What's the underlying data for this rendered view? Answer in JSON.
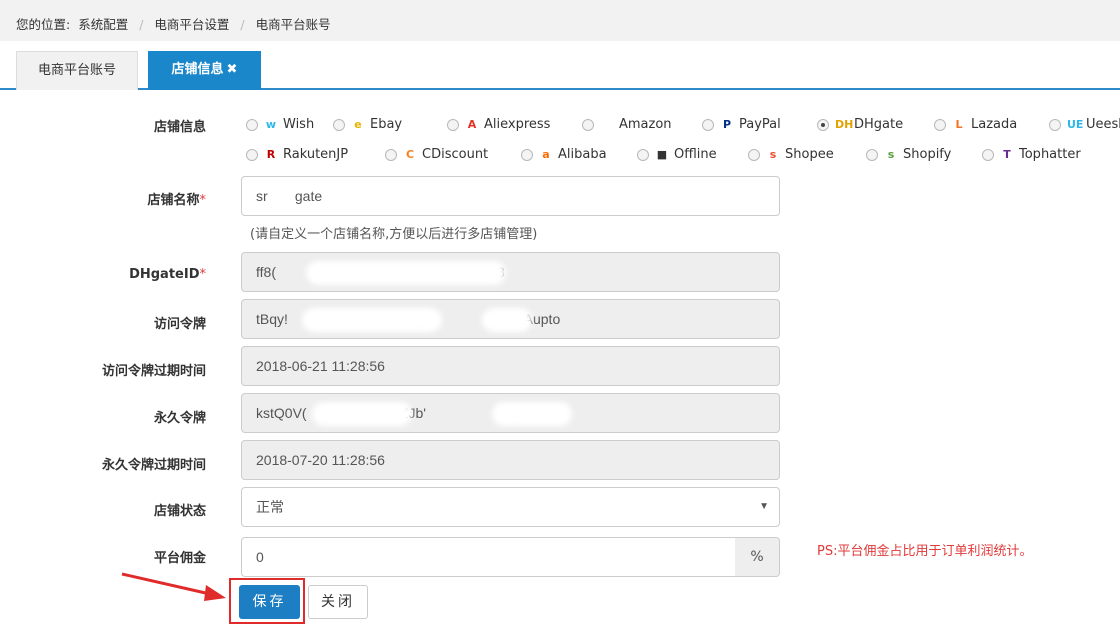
{
  "breadcrumb": {
    "prefix": "您的位置:",
    "items": [
      "系统配置",
      "电商平台设置",
      "电商平台账号"
    ]
  },
  "tabs": [
    {
      "label": "电商平台账号"
    },
    {
      "label": "店铺信息",
      "close": "✖"
    }
  ],
  "form": {
    "platform_label": "店铺信息",
    "platforms": [
      {
        "name": "Wish",
        "icon": "wish-icon",
        "color": "#2fb7ec",
        "glyph": "w",
        "selected": false
      },
      {
        "name": "Ebay",
        "icon": "ebay-icon",
        "color": "#e5b400",
        "glyph": "e",
        "selected": false
      },
      {
        "name": "Aliexpress",
        "icon": "aliexpress-icon",
        "color": "#e43225",
        "glyph": "A",
        "selected": false
      },
      {
        "name": "Amazon",
        "icon": "",
        "color": "",
        "glyph": "",
        "selected": false
      },
      {
        "name": "PayPal",
        "icon": "paypal-icon",
        "color": "#003087",
        "glyph": "P",
        "selected": false
      },
      {
        "name": "DHgate",
        "icon": "dhgate-icon",
        "color": "#e5a100",
        "glyph": "DH",
        "selected": true
      },
      {
        "name": "Lazada",
        "icon": "lazada-icon",
        "color": "#f57224",
        "glyph": "L",
        "selected": false
      },
      {
        "name": "Ueeshop",
        "icon": "ueeshop-icon",
        "color": "#2fb7ec",
        "glyph": "UE",
        "selected": false
      },
      {
        "name": "RakutenJP",
        "icon": "rakuten-icon",
        "color": "#bf0000",
        "glyph": "R",
        "selected": false
      },
      {
        "name": "CDiscount",
        "icon": "cdiscount-icon",
        "color": "#f58220",
        "glyph": "C",
        "selected": false
      },
      {
        "name": "Alibaba",
        "icon": "alibaba-icon",
        "color": "#ff6a00",
        "glyph": "a",
        "selected": false
      },
      {
        "name": "Offline",
        "icon": "offline-icon",
        "color": "#333333",
        "glyph": "■",
        "selected": false
      },
      {
        "name": "Shopee",
        "icon": "shopee-icon",
        "color": "#ee4d2d",
        "glyph": "s",
        "selected": false
      },
      {
        "name": "Shopify",
        "icon": "shopify-icon",
        "color": "#5a9e3a",
        "glyph": "s",
        "selected": false
      },
      {
        "name": "Tophatter",
        "icon": "tophatter-icon",
        "color": "#6a2c91",
        "glyph": "T",
        "selected": false
      }
    ],
    "store_name_label": "店铺名称",
    "store_name_value": "sr       gate",
    "store_name_hint": "(请自定义一个店铺名称,方便以后进行多店铺管理)",
    "dhgate_id_label": "DHgateID",
    "dhgate_id_value": "ff8(                                             c4a08d3",
    "access_token_label": "访问令牌",
    "access_token_value": "tBqy!                              ‡fgu                /xlaaAupto",
    "access_token_expiry_label": "访问令牌过期时间",
    "access_token_expiry_value": "2018-06-21 11:28:56",
    "refresh_token_label": "永久令牌",
    "refresh_token_value": "kstQ0V(                      aZJb'                    PjH",
    "refresh_token_expiry_label": "永久令牌过期时间",
    "refresh_token_expiry_value": "2018-07-20 11:28:56",
    "store_status_label": "店铺状态",
    "store_status_value": "正常",
    "commission_label": "平台佣金",
    "commission_value": "0",
    "commission_unit": "%",
    "commission_note": "PS:平台佣金占比用于订单利润统计。",
    "required_mark": "*"
  },
  "buttons": {
    "save": "保存",
    "close": "关闭"
  },
  "colors": {
    "accent": "#1987c9",
    "required": "#e03a3a",
    "annotation": "#e02b2b"
  }
}
